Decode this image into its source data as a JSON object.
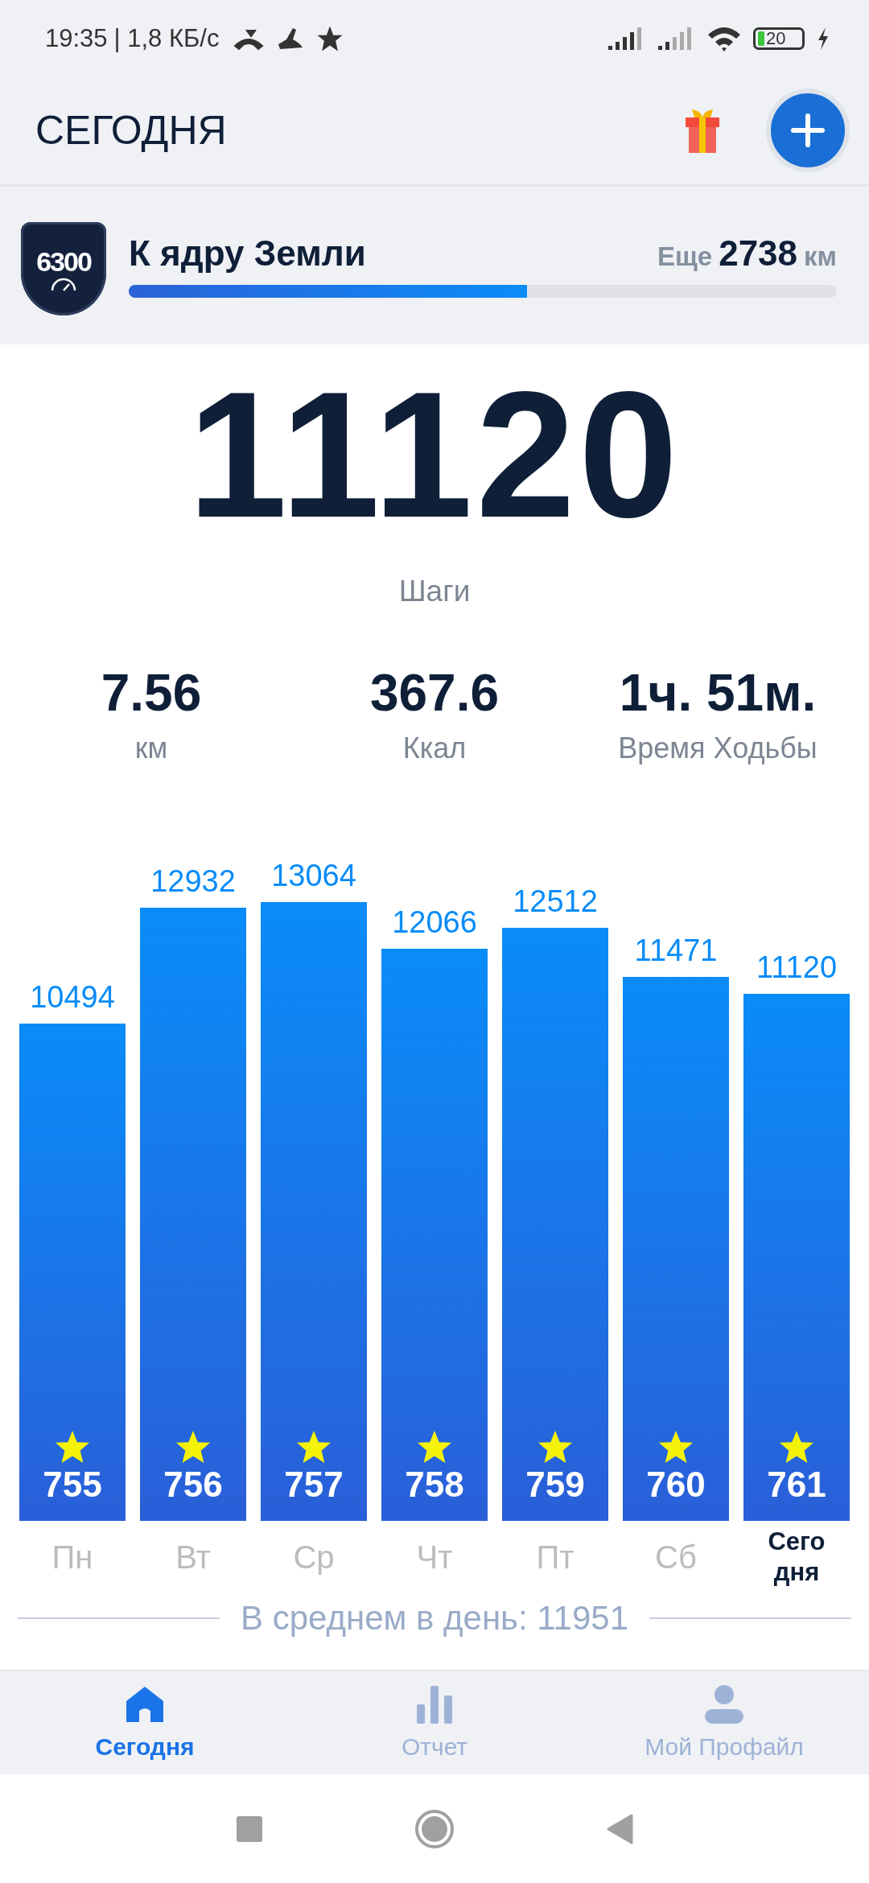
{
  "status_bar": {
    "time": "19:35",
    "speed": "| 1,8 КБ/с",
    "battery": "20"
  },
  "header": {
    "title": "СЕГОДНЯ"
  },
  "goal": {
    "badge": "6300",
    "title": "К ядру Земли",
    "remaining_prefix": "Еще",
    "remaining_value": "2738",
    "remaining_unit": "км",
    "level": 0.563
  },
  "steps": {
    "value": "11120",
    "label": "Шаги"
  },
  "stats": [
    {
      "value": "7.56",
      "label": "км"
    },
    {
      "value": "367.6",
      "label": "Ккал"
    },
    {
      "value": "1ч. 51м.",
      "label": "Время Ходьбы"
    }
  ],
  "chart_data": {
    "type": "bar",
    "categories": [
      "Пн",
      "Вт",
      "Ср",
      "Чт",
      "Пт",
      "Сб",
      "Сегодня"
    ],
    "series": [
      {
        "color": "#0a8cf8",
        "values": [
          10494,
          12932,
          13064,
          12066,
          12512,
          11471,
          11120
        ]
      }
    ],
    "data_labels": true
  },
  "bar_details": [
    {
      "count": "755",
      "selected": false
    },
    {
      "count": "756",
      "selected": false
    },
    {
      "count": "757",
      "selected": false
    },
    {
      "count": "758",
      "selected": false
    },
    {
      "count": "759",
      "selected": false
    },
    {
      "count": "760",
      "selected": false
    },
    {
      "count": "761",
      "selected": true
    }
  ],
  "average": "В среднем в день: 11951",
  "nav": [
    {
      "kind": "home",
      "label": "Сегодня",
      "selected": true
    },
    {
      "kind": "report",
      "label": "Отчет",
      "selected": false
    },
    {
      "kind": "profile",
      "label": "Мой Профайл",
      "selected": false
    }
  ]
}
